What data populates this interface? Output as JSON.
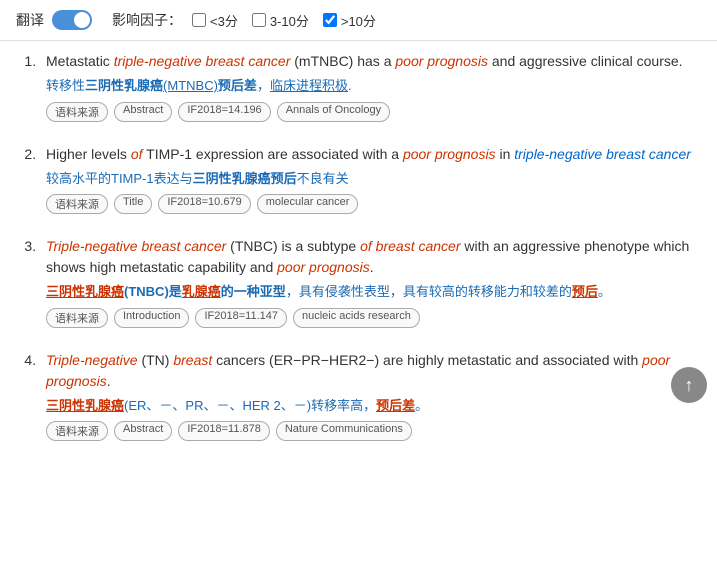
{
  "toolbar": {
    "translate_label": "翻译",
    "influence_label": "影响因子：",
    "filter_lt3_label": "<3分",
    "filter_3_10_label": "3-10分",
    "filter_gt10_label": ">10分",
    "filter_lt3_checked": false,
    "filter_3_10_checked": false,
    "filter_gt10_checked": true
  },
  "results": [
    {
      "id": 1,
      "en_text": "Metastatic triple-negative breast cancer (mTNBC) has a poor prognosis and aggressive clinical course.",
      "zh_text": "转移性三阴性乳腺癌(MTNBC)预后差，临床进程积极.",
      "tags": [
        "语料来源",
        "Abstract",
        "IF2018=14.196",
        "Annals of Oncology"
      ]
    },
    {
      "id": 2,
      "en_text": "Higher levels of TIMP-1 expression are associated with a poor prognosis in triple-negative breast cancer",
      "zh_text": "较高水平的TIMP-1表达与三阴性乳腺癌预后不良有关",
      "tags": [
        "语料来源",
        "Title",
        "IF2018=10.679",
        "molecular cancer"
      ]
    },
    {
      "id": 3,
      "en_text": "Triple-negative breast cancer (TNBC) is a subtype of breast cancer with an aggressive phenotype which shows high metastatic capability and poor prognosis.",
      "zh_text": "三阴性乳腺癌(TNBC)是乳腺癌的一种亚型，具有侵袭性表型，具有较高的转移能力和较差的预后。",
      "tags": [
        "语料来源",
        "Introduction",
        "IF2018=11.147",
        "nucleic acids research"
      ]
    },
    {
      "id": 4,
      "en_text": "Triple-negative (TN) breast cancers (ER−PR−HER2−) are highly metastatic and associated with poor prognosis.",
      "zh_text": "三阴性乳腺癌(ER、－、PR、－、HER 2、－)转移率高，预后差。",
      "tags": [
        "语料来源",
        "Abstract",
        "IF2018=11.878",
        "Nature Communications"
      ]
    }
  ],
  "scroll_top_label": "↑"
}
